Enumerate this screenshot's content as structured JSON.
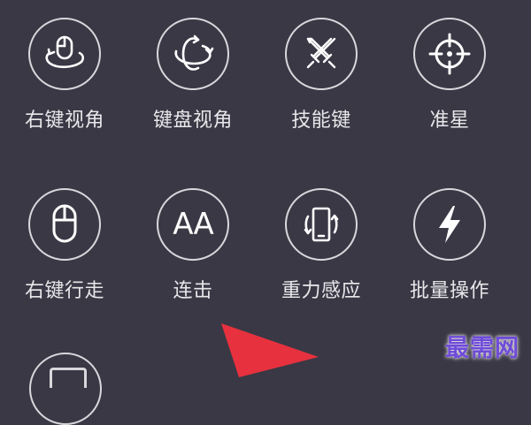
{
  "colors": {
    "background": "#3a3845",
    "icon": "#ffffff",
    "ring": "#d8d8dc",
    "label": "#e8e8ea",
    "arrow": "#e8313e",
    "watermark": "#6f4bd8"
  },
  "tiles": [
    {
      "label": "右键视角",
      "icon": "mouse-rotate-icon"
    },
    {
      "label": "键盘视角",
      "icon": "rotate-3d-icon"
    },
    {
      "label": "技能键",
      "icon": "crossed-swords-icon"
    },
    {
      "label": "准星",
      "icon": "crosshair-icon"
    },
    {
      "label": "右键行走",
      "icon": "mouse-icon"
    },
    {
      "label": "连击",
      "icon": "aa-text-icon",
      "icon_text": "AA"
    },
    {
      "label": "重力感应",
      "icon": "phone-rotate-icon"
    },
    {
      "label": "批量操作",
      "icon": "lightning-icon"
    }
  ],
  "watermark": {
    "text": "最需网"
  }
}
